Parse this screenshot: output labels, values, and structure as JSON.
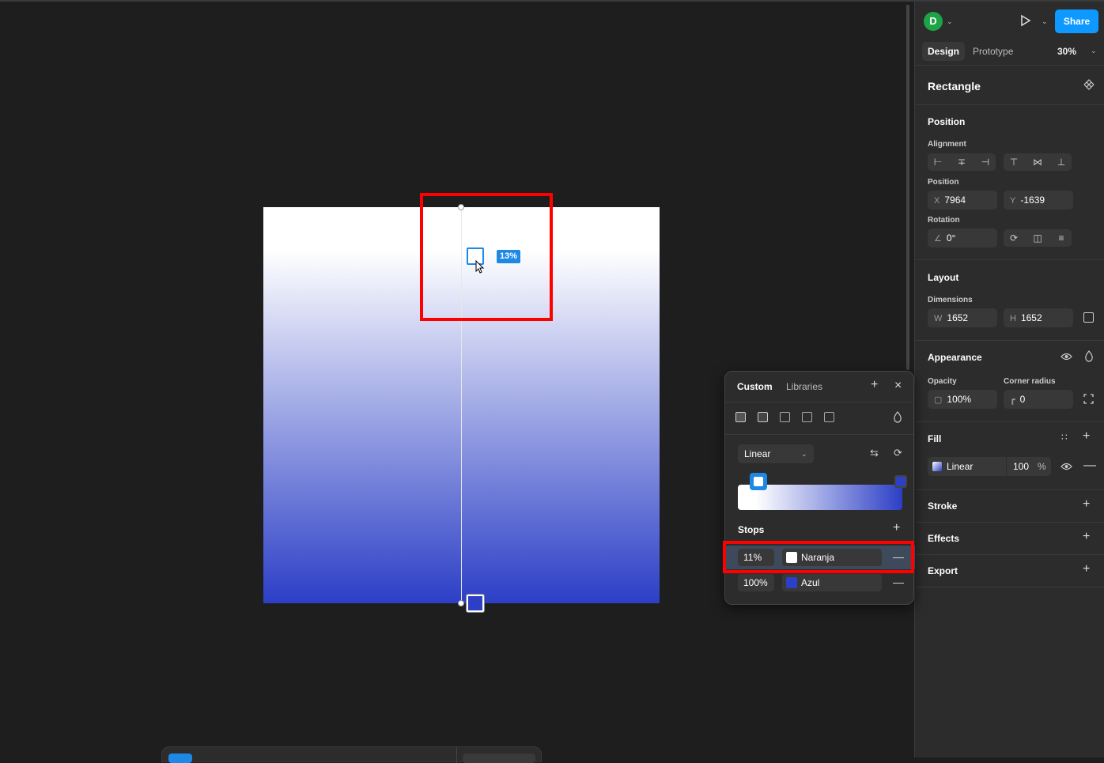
{
  "canvas": {
    "gradient_label": "13%",
    "gradient_colors": {
      "start": "#ffffff",
      "end": "#2c3fc6"
    },
    "highlight_color": "#ff0000"
  },
  "header": {
    "avatar_letter": "D",
    "share_label": "Share",
    "tabs": [
      {
        "label": "Design"
      },
      {
        "label": "Prototype"
      }
    ],
    "zoom": "30%"
  },
  "panel": {
    "layer_name": "Rectangle",
    "position_section": "Position",
    "alignment_label": "Alignment",
    "position_label": "Position",
    "x_prefix": "X",
    "x_value": "7964",
    "y_prefix": "Y",
    "y_value": "-1639",
    "rotation_label": "Rotation",
    "rotation_value": "0°",
    "layout_section": "Layout",
    "dimensions_label": "Dimensions",
    "w_prefix": "W",
    "w_value": "1652",
    "h_prefix": "H",
    "h_value": "1652",
    "appearance_section": "Appearance",
    "opacity_label": "Opacity",
    "opacity_value": "100%",
    "corner_label": "Corner radius",
    "corner_value": "0",
    "fill_section": "Fill",
    "fill_type": "Linear",
    "fill_opacity": "100",
    "fill_pct": "%",
    "stroke_section": "Stroke",
    "effects_section": "Effects",
    "export_section": "Export"
  },
  "picker": {
    "tab_custom": "Custom",
    "tab_libraries": "Libraries",
    "gradient_type": "Linear",
    "stops_title": "Stops",
    "stops": [
      {
        "position": "11%",
        "name": "Naranja",
        "color": "#ffffff"
      },
      {
        "position": "100%",
        "name": "Azul",
        "color": "#2c3fc6"
      }
    ]
  }
}
